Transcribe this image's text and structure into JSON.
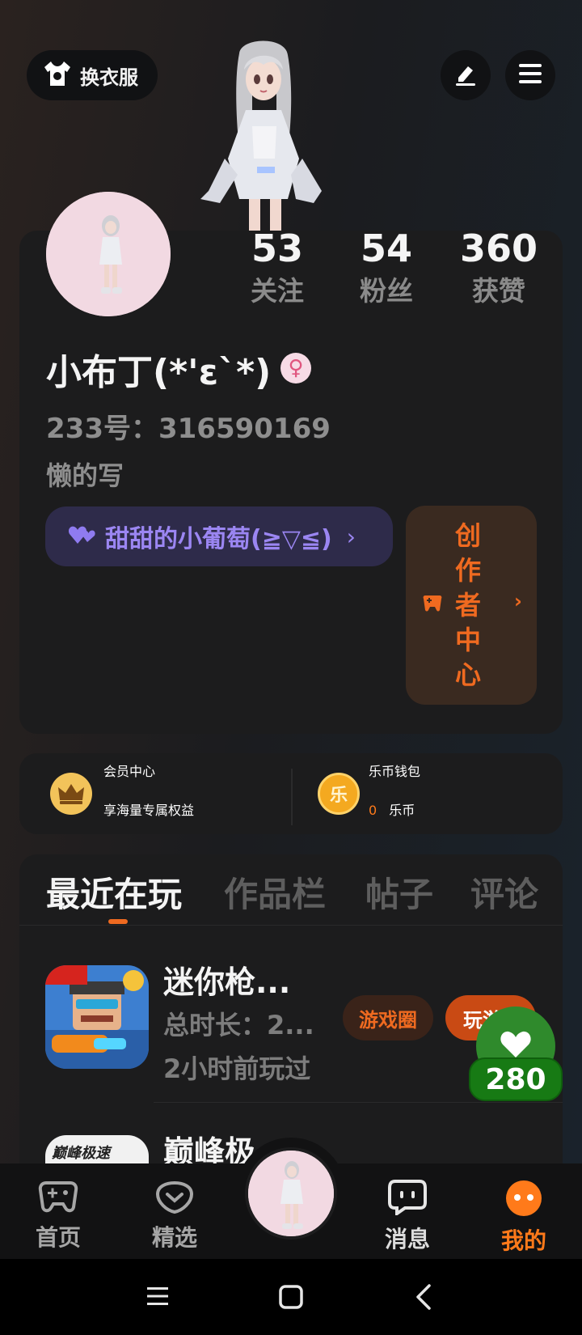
{
  "header": {
    "outfit_label": "换衣服",
    "edit_icon": "pencil-icon",
    "menu_icon": "hamburger-menu-icon"
  },
  "profile": {
    "stats": [
      {
        "num": "53",
        "label": "关注"
      },
      {
        "num": "54",
        "label": "粉丝"
      },
      {
        "num": "360",
        "label": "获赞"
      }
    ],
    "username": "小布丁(*'ε`*)",
    "gender_symbol": "♀",
    "uid": "233号：316590169",
    "bio": "懒的写",
    "fan_badge": "甜甜的小葡萄(≧▽≦)",
    "creator_center": "创作者中心"
  },
  "membership": {
    "title": "会员中心",
    "subtitle": "享海量专属权益"
  },
  "wallet": {
    "title": "乐币钱包",
    "amount": "0",
    "unit": "乐币",
    "coin_glyph": "乐"
  },
  "tabs": [
    "最近在玩",
    "作品栏",
    "帖子",
    "评论"
  ],
  "games": [
    {
      "title": "迷你枪...",
      "total_time": "总时长：2...",
      "last_played": "2小时前玩过",
      "circle_btn": "游戏圈",
      "play_btn": "玩游戏"
    },
    {
      "title": "巅峰极",
      "icon_text": "巅峰极速"
    }
  ],
  "like": {
    "count": "280"
  },
  "nav": [
    {
      "label": "首页",
      "icon": "gamepad-icon"
    },
    {
      "label": "精选",
      "icon": "heart-chat-icon"
    },
    {
      "label": "消息",
      "icon": "message-icon"
    },
    {
      "label": "我的",
      "icon": "profile-face-icon"
    }
  ],
  "colors": {
    "accent": "#ef6a20",
    "fan_badge_text": "#9b86f2",
    "like_green": "#177a14"
  }
}
